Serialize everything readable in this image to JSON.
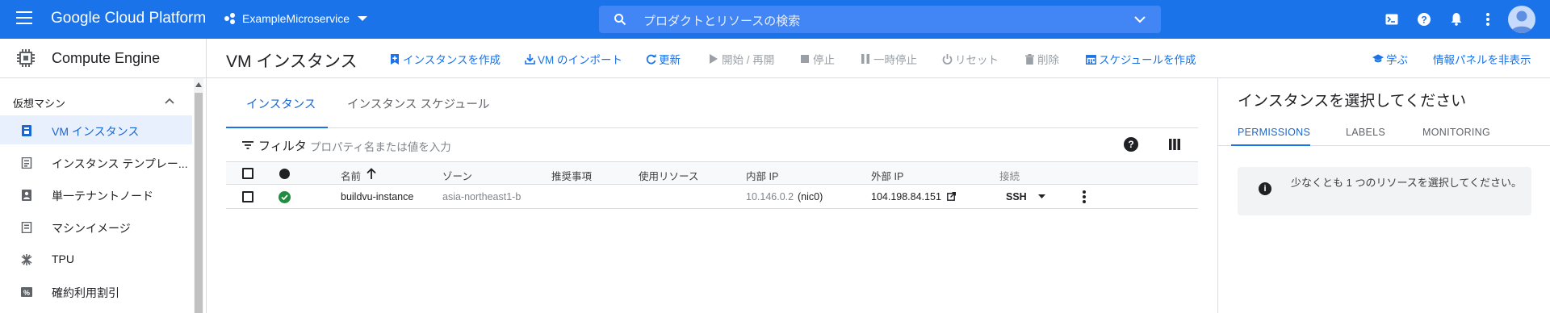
{
  "topbar": {
    "brand": "Google Cloud Platform",
    "project": "ExampleMicroservice",
    "search_placeholder": "プロダクトとリソースの検索"
  },
  "subheader": {
    "product_title": "Compute Engine",
    "page_title": "VM インスタンス",
    "actions": [
      {
        "label": "インスタンスを作成",
        "icon": "add-box-icon",
        "enabled": true
      },
      {
        "label": "VM のインポート",
        "icon": "import-icon",
        "enabled": true
      },
      {
        "label": "更新",
        "icon": "refresh-icon",
        "enabled": true
      },
      {
        "label": "開始 / 再開",
        "icon": "play-icon",
        "enabled": false
      },
      {
        "label": "停止",
        "icon": "stop-icon",
        "enabled": false
      },
      {
        "label": "一時停止",
        "icon": "pause-icon",
        "enabled": false
      },
      {
        "label": "リセット",
        "icon": "power-icon",
        "enabled": false
      },
      {
        "label": "削除",
        "icon": "trash-icon",
        "enabled": false
      },
      {
        "label": "スケジュールを作成",
        "icon": "calendar-icon",
        "enabled": true
      }
    ],
    "learn": "学ぶ",
    "hide_panel": "情報パネルを非表示"
  },
  "sidebar": {
    "section": "仮想マシン",
    "items": [
      {
        "label": "VM インスタンス",
        "icon": "vm-instance-icon",
        "active": true
      },
      {
        "label": "インスタンス テンプレー...",
        "icon": "instance-template-icon",
        "active": false
      },
      {
        "label": "単一テナントノード",
        "icon": "sole-tenant-icon",
        "active": false
      },
      {
        "label": "マシンイメージ",
        "icon": "machine-image-icon",
        "active": false
      },
      {
        "label": "TPU",
        "icon": "tpu-icon",
        "active": false
      },
      {
        "label": "確約利用割引",
        "icon": "percent-icon",
        "active": false
      }
    ]
  },
  "main": {
    "tabs": [
      "インスタンス",
      "インスタンス スケジュール"
    ],
    "filter_label": "フィルタ",
    "filter_placeholder": "プロパティ名または値を入力",
    "columns": {
      "name": "名前",
      "zone": "ゾーン",
      "recommendation": "推奨事項",
      "in_use_by": "使用リソース",
      "internal_ip": "内部 IP",
      "external_ip": "外部 IP",
      "connect": "接続"
    },
    "rows": [
      {
        "name": "buildvu-instance",
        "zone": "asia-northeast1-b",
        "recommendation": "",
        "in_use_by": "",
        "internal_ip": "10.146.0.2",
        "internal_nic": "(nic0)",
        "external_ip": "104.198.84.151",
        "connect": "SSH"
      }
    ]
  },
  "right_panel": {
    "title": "インスタンスを選択してください",
    "tabs": [
      "PERMISSIONS",
      "LABELS",
      "MONITORING"
    ],
    "info": "少なくとも 1 つのリソースを選択してください。"
  },
  "colors": {
    "brand_blue": "#1a73e8",
    "status_green": "#1e8e3e",
    "active_bg": "#e8f0fe"
  }
}
